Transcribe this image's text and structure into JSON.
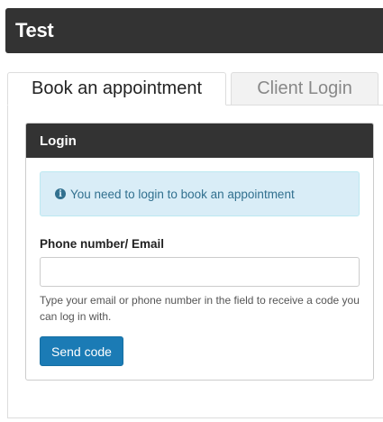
{
  "header": {
    "title": "Test"
  },
  "tabs": [
    {
      "label": "Book an appointment",
      "active": true
    },
    {
      "label": "Client Login",
      "active": false
    }
  ],
  "panel": {
    "title": "Login",
    "alert": {
      "icon": "info-icon",
      "icon_glyph": "i",
      "text": "You need to login to book an appointment"
    },
    "field": {
      "label": "Phone number/ Email",
      "value": "",
      "placeholder": "",
      "help": "Type your email or phone number in the field to receive a code you can log in with."
    },
    "submit_label": "Send code"
  },
  "colors": {
    "header_bg": "#333333",
    "alert_bg": "#d9edf7",
    "alert_text": "#31708f",
    "button_bg": "#1b7bb5"
  }
}
